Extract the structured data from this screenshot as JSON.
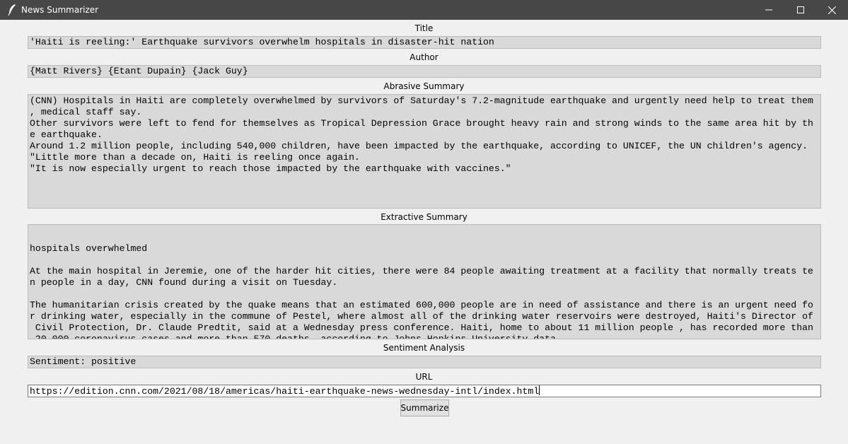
{
  "window": {
    "title": "News Summarizer"
  },
  "labels": {
    "title": "Title",
    "author": "Author",
    "abrasive": "Abrasive Summary",
    "extractive": "Extractive Summary",
    "sentiment": "Sentiment Analysis",
    "url": "URL"
  },
  "fields": {
    "title": "'Haiti is reeling:' Earthquake survivors overwhelm hospitals in disaster-hit nation",
    "author": "{Matt Rivers} {Etant Dupain} {Jack Guy}",
    "abrasive_summary": "(CNN) Hospitals in Haiti are completely overwhelmed by survivors of Saturday's 7.2-magnitude earthquake and urgently need help to treat them\n, medical staff say.\nOther survivors were left to fend for themselves as Tropical Depression Grace brought heavy rain and strong winds to the same area hit by th\ne earthquake.\nAround 1.2 million people, including 540,000 children, have been impacted by the earthquake, according to UNICEF, the UN children's agency.\n\"Little more than a decade on, Haiti is reeling once again.\n\"It is now especially urgent to reach those impacted by the earthquake with vaccines.\"",
    "extractive_summary": "hospitals overwhelmed\n\nAt the main hospital in Jeremie, one of the harder hit cities, there were 84 people awaiting treatment at a facility that normally treats te\nn people in a day, CNN found during a visit on Tuesday.\n\nThe humanitarian crisis created by the quake means that an estimated 600,000 people are in need of assistance and there is an urgent need fo\nr drinking water, especially in the commune of Pestel, where almost all of the drinking water reservoirs were destroyed, Haiti's Director of\n Civil Protection, Dr. Claude Predtit, said at a Wednesday press conference. Haiti, home to about 11 million people , has recorded more than\n 20,000 coronavirus cases and more than 570 deaths, according to Johns Hopkins University data\n\n\"We lost many people in the disaster, let's avoid losing more because of the pandemic,\" Henry said.",
    "sentiment": "Sentiment: positive",
    "url": "https://edition.cnn.com/2021/08/18/americas/haiti-earthquake-news-wednesday-intl/index.html"
  },
  "buttons": {
    "summarize": "Summarize"
  },
  "icons": {
    "app": "feather-icon",
    "minimize": "minimize-icon",
    "maximize": "maximize-icon",
    "close": "close-icon"
  }
}
